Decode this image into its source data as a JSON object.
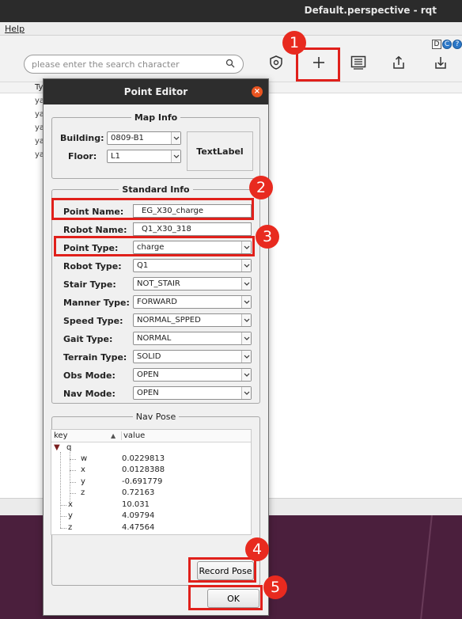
{
  "window": {
    "title": "Default.perspective - rqt"
  },
  "menu": {
    "help": "Help"
  },
  "toolbar": {
    "search_placeholder": "please enter the search character",
    "mini_icons": [
      "D",
      "C",
      "?"
    ],
    "icons": [
      "shield-icon",
      "add-icon",
      "list-icon",
      "upload-icon",
      "download-icon"
    ]
  },
  "background_table": {
    "header": "Ty",
    "cells": [
      "ya",
      "ya",
      "ya",
      "ya",
      "ya"
    ]
  },
  "dialog": {
    "title": "Point Editor",
    "close_symbol": "×",
    "map_info": {
      "title": "Map Info",
      "building_label": "Building:",
      "building_value": "0809-B1",
      "floor_label": "Floor:",
      "floor_value": "L1",
      "text_label": "TextLabel"
    },
    "standard_info": {
      "title": "Standard Info",
      "point_name_label": "Point Name:",
      "point_name_value": "EG_X30_charge",
      "robot_name_label": "Robot Name:",
      "robot_name_value": "Q1_X30_318",
      "point_type_label": "Point Type:",
      "point_type_value": "charge",
      "robot_type_label": "Robot Type:",
      "robot_type_value": "Q1",
      "stair_type_label": "Stair Type:",
      "stair_type_value": "NOT_STAIR",
      "manner_type_label": "Manner Type:",
      "manner_type_value": "FORWARD",
      "speed_type_label": "Speed Type:",
      "speed_type_value": "NORMAL_SPPED",
      "gait_type_label": "Gait Type:",
      "gait_type_value": "NORMAL",
      "terrain_type_label": "Terrain Type:",
      "terrain_type_value": "SOLID",
      "obs_mode_label": "Obs Mode:",
      "obs_mode_value": "OPEN",
      "nav_mode_label": "Nav Mode:",
      "nav_mode_value": "OPEN"
    },
    "nav_pose": {
      "title": "Nav Pose",
      "col_key": "key",
      "col_value": "value",
      "q_key": "q",
      "qw_key": "w",
      "qw_value": "0.0229813",
      "qx_key": "x",
      "qx_value": "0.0128388",
      "qy_key": "y",
      "qy_value": "-0.691779",
      "qz_key": "z",
      "qz_value": "0.72163",
      "x_key": "x",
      "x_value": "10.031",
      "y_key": "y",
      "y_value": "4.09794",
      "z_key": "z",
      "z_value": "4.47564"
    },
    "record_pose_label": "Record Pose",
    "ok_label": "OK"
  },
  "annotations": {
    "color": "#e0201b",
    "badges": [
      "1",
      "2",
      "3",
      "4",
      "5"
    ]
  }
}
